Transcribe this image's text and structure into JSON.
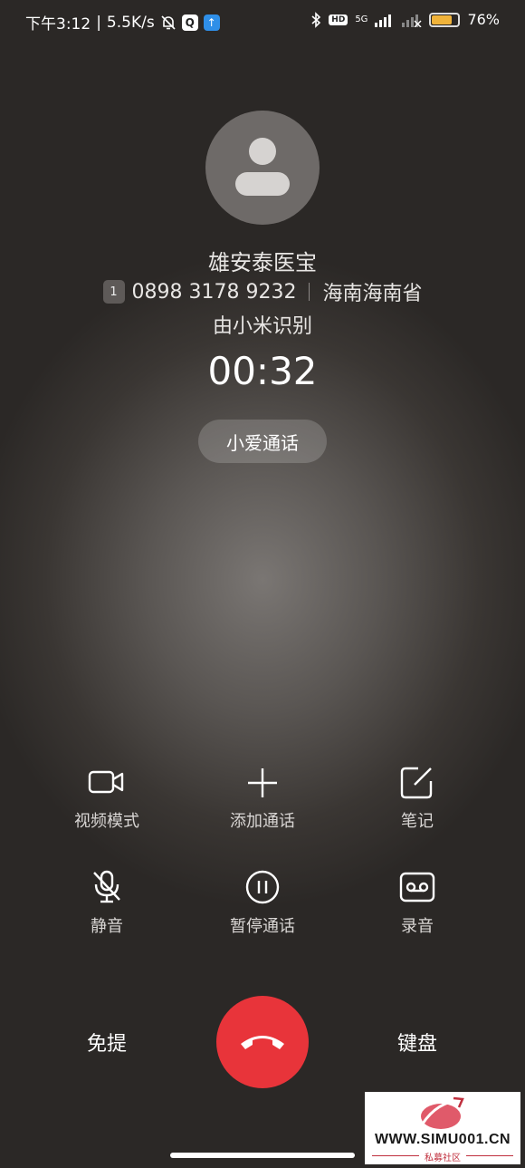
{
  "status_bar": {
    "time": "下午3:12",
    "speed": "5.5K/s",
    "hd": "HD",
    "network": "5G",
    "battery_level": 0.76,
    "battery_text": "76%"
  },
  "caller": {
    "name": "雄安泰医宝",
    "sim_slot": "1",
    "number": "0898 3178 9232",
    "location": "海南海南省",
    "identified_by": "由小米识别",
    "duration": "00:32",
    "assistant_button": "小爱通话"
  },
  "controls": {
    "video": "视频模式",
    "add_call": "添加通话",
    "notes": "笔记",
    "mute": "静音",
    "hold": "暂停通话",
    "record": "录音"
  },
  "bottom": {
    "speaker": "免提",
    "keypad": "键盘"
  },
  "watermark": {
    "site": "WWW.SIMU001.CN",
    "subtitle": "私募社区"
  },
  "colors": {
    "hangup": "#e8343a",
    "battery": "#f0b33a"
  }
}
